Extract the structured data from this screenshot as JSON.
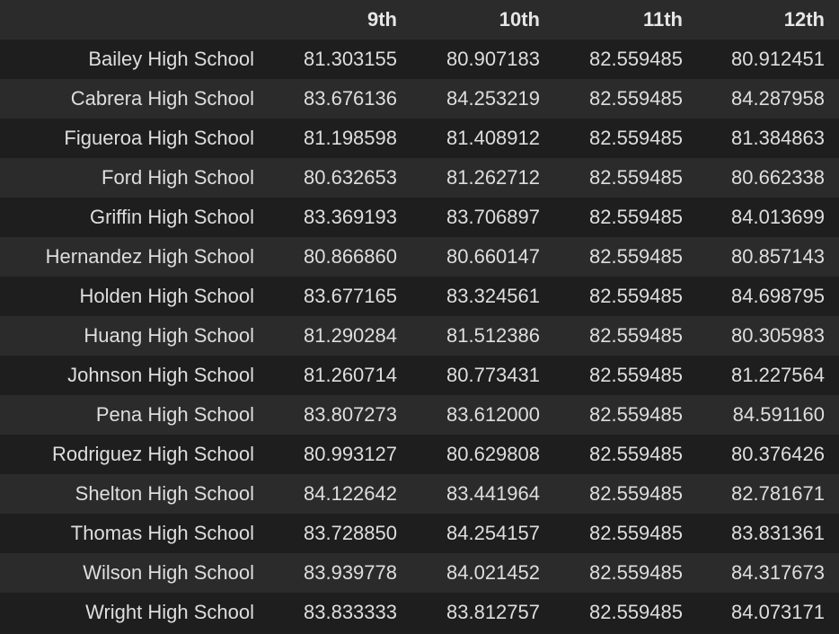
{
  "table": {
    "columns": [
      "",
      "9th",
      "10th",
      "11th",
      "12th"
    ],
    "rows": [
      {
        "school": "Bailey High School",
        "values": [
          "81.303155",
          "80.907183",
          "82.559485",
          "80.912451"
        ]
      },
      {
        "school": "Cabrera High School",
        "values": [
          "83.676136",
          "84.253219",
          "82.559485",
          "84.287958"
        ]
      },
      {
        "school": "Figueroa High School",
        "values": [
          "81.198598",
          "81.408912",
          "82.559485",
          "81.384863"
        ]
      },
      {
        "school": "Ford High School",
        "values": [
          "80.632653",
          "81.262712",
          "82.559485",
          "80.662338"
        ]
      },
      {
        "school": "Griffin High School",
        "values": [
          "83.369193",
          "83.706897",
          "82.559485",
          "84.013699"
        ]
      },
      {
        "school": "Hernandez High School",
        "values": [
          "80.866860",
          "80.660147",
          "82.559485",
          "80.857143"
        ]
      },
      {
        "school": "Holden High School",
        "values": [
          "83.677165",
          "83.324561",
          "82.559485",
          "84.698795"
        ]
      },
      {
        "school": "Huang High School",
        "values": [
          "81.290284",
          "81.512386",
          "82.559485",
          "80.305983"
        ]
      },
      {
        "school": "Johnson High School",
        "values": [
          "81.260714",
          "80.773431",
          "82.559485",
          "81.227564"
        ]
      },
      {
        "school": "Pena High School",
        "values": [
          "83.807273",
          "83.612000",
          "82.559485",
          "84.591160"
        ]
      },
      {
        "school": "Rodriguez High School",
        "values": [
          "80.993127",
          "80.629808",
          "82.559485",
          "80.376426"
        ]
      },
      {
        "school": "Shelton High School",
        "values": [
          "84.122642",
          "83.441964",
          "82.559485",
          "82.781671"
        ]
      },
      {
        "school": "Thomas High School",
        "values": [
          "83.728850",
          "84.254157",
          "82.559485",
          "83.831361"
        ]
      },
      {
        "school": "Wilson High School",
        "values": [
          "83.939778",
          "84.021452",
          "82.559485",
          "84.317673"
        ]
      },
      {
        "school": "Wright High School",
        "values": [
          "83.833333",
          "83.812757",
          "82.559485",
          "84.073171"
        ]
      }
    ]
  }
}
